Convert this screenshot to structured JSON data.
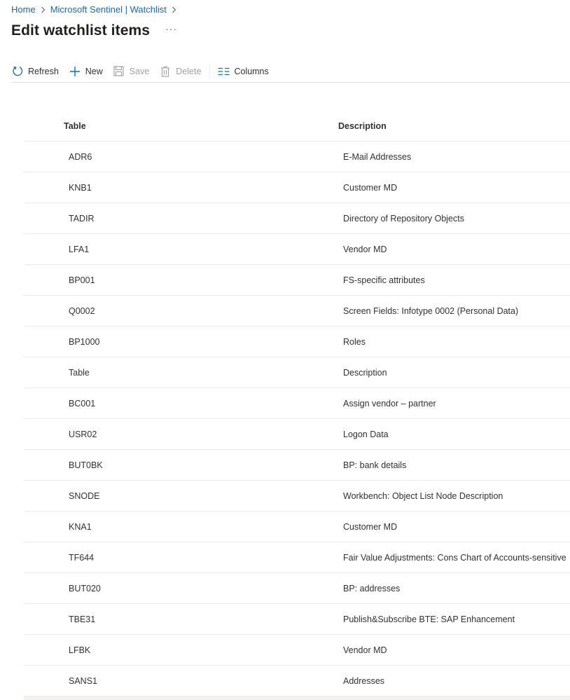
{
  "breadcrumb": {
    "home": "Home",
    "parent": "Microsoft Sentinel | Watchlist"
  },
  "page": {
    "title": "Edit watchlist items",
    "more": "···"
  },
  "toolbar": {
    "refresh": "Refresh",
    "new": "New",
    "save": "Save",
    "delete": "Delete",
    "columns": "Columns"
  },
  "colors": {
    "accent": "#0f6cbd",
    "disabled": "#a19f9d",
    "border": "#edebe9"
  },
  "table": {
    "columns": [
      "Table",
      "Description"
    ],
    "rows": [
      [
        "ADR6",
        "E-Mail Addresses"
      ],
      [
        "KNB1",
        "Customer MD"
      ],
      [
        "TADIR",
        "Directory of Repository Objects"
      ],
      [
        "LFA1",
        "Vendor MD"
      ],
      [
        "BP001",
        "FS-specific attributes"
      ],
      [
        "Q0002",
        "Screen Fields: Infotype 0002 (Personal Data)"
      ],
      [
        "BP1000",
        "Roles"
      ],
      [
        "Table",
        "Description"
      ],
      [
        "BC001",
        "Assign vendor – partner"
      ],
      [
        "USR02",
        "Logon Data"
      ],
      [
        "BUT0BK",
        "BP: bank details"
      ],
      [
        "SNODE",
        "Workbench: Object List Node Description"
      ],
      [
        "KNA1",
        "Customer MD"
      ],
      [
        "TF644",
        "Fair Value Adjustments: Cons Chart of Accounts-sensitive"
      ],
      [
        "BUT020",
        "BP: addresses"
      ],
      [
        "TBE31",
        "Publish&Subscribe BTE: SAP Enhancement"
      ],
      [
        "LFBK",
        "Vendor MD"
      ],
      [
        "SANS1",
        "Addresses"
      ]
    ]
  }
}
